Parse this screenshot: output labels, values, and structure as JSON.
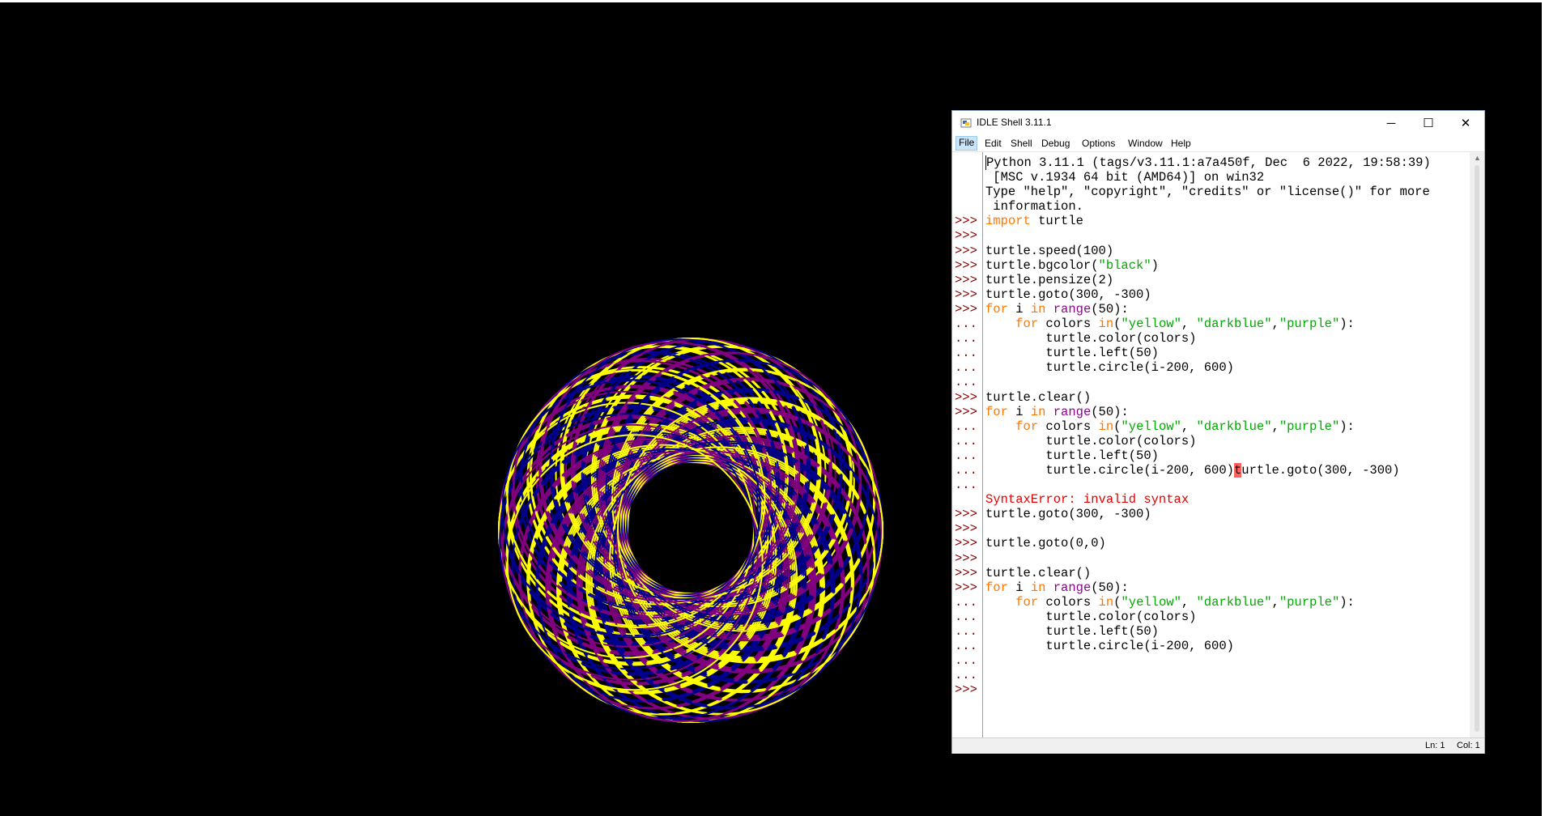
{
  "window": {
    "title": "IDLE Shell 3.11.1",
    "menu": [
      "File",
      "Edit",
      "Shell",
      "Debug",
      "Options",
      "Window",
      "Help"
    ],
    "active_menu": "File",
    "controls": {
      "minimize": "─",
      "maximize": "☐",
      "close": "✕"
    }
  },
  "shell": {
    "banner": [
      "Python 3.11.1 (tags/v3.11.1:a7a450f, Dec  6 2022, 19:58:39)",
      " [MSC v.1934 64 bit (AMD64)] on win32",
      "Type \"help\", \"copyright\", \"credits\" or \"license()\" for more",
      " information."
    ],
    "lines": [
      {
        "prompt": ">>>",
        "text": "import turtle"
      },
      {
        "prompt": ">>>",
        "text": ""
      },
      {
        "prompt": ">>>",
        "text": "turtle.speed(100)"
      },
      {
        "prompt": ">>>",
        "text": "turtle.bgcolor(\"black\")"
      },
      {
        "prompt": ">>>",
        "text": "turtle.pensize(2)"
      },
      {
        "prompt": ">>>",
        "text": "turtle.goto(300, -300)"
      },
      {
        "prompt": ">>>",
        "text": "for i in range(50):"
      },
      {
        "prompt": "...",
        "text": "    for colors in(\"yellow\", \"darkblue\",\"purple\"):"
      },
      {
        "prompt": "...",
        "text": "        turtle.color(colors)"
      },
      {
        "prompt": "...",
        "text": "        turtle.left(50)"
      },
      {
        "prompt": "...",
        "text": "        turtle.circle(i-200, 600)"
      },
      {
        "prompt": "...",
        "text": ""
      },
      {
        "prompt": ">>>",
        "text": "turtle.clear()"
      },
      {
        "prompt": ">>>",
        "text": "for i in range(50):"
      },
      {
        "prompt": "...",
        "text": "    for colors in(\"yellow\", \"darkblue\",\"purple\"):"
      },
      {
        "prompt": "...",
        "text": "        turtle.color(colors)"
      },
      {
        "prompt": "...",
        "text": "        turtle.left(50)"
      },
      {
        "prompt": "...",
        "text": "        turtle.circle(i-200, 600)turtle.goto(300, -300)"
      },
      {
        "prompt": "...",
        "text": ""
      },
      {
        "prompt": "",
        "text": "SyntaxError: invalid syntax"
      },
      {
        "prompt": ">>>",
        "text": "turtle.goto(300, -300)"
      },
      {
        "prompt": ">>>",
        "text": ""
      },
      {
        "prompt": ">>>",
        "text": "turtle.goto(0,0)"
      },
      {
        "prompt": ">>>",
        "text": ""
      },
      {
        "prompt": ">>>",
        "text": "turtle.clear()"
      },
      {
        "prompt": ">>>",
        "text": "for i in range(50):"
      },
      {
        "prompt": "...",
        "text": "    for colors in(\"yellow\", \"darkblue\",\"purple\"):"
      },
      {
        "prompt": "...",
        "text": "        turtle.color(colors)"
      },
      {
        "prompt": "...",
        "text": "        turtle.left(50)"
      },
      {
        "prompt": "...",
        "text": "        turtle.circle(i-200, 600)"
      },
      {
        "prompt": "...",
        "text": ""
      },
      {
        "prompt": "...",
        "text": ""
      },
      {
        "prompt": ">>>",
        "text": ""
      }
    ]
  },
  "status": {
    "line": "Ln: 1",
    "col": "Col: 1"
  },
  "turtle_drawing": {
    "background": "#000000",
    "pen_colors": [
      "yellow",
      "darkblue",
      "purple"
    ]
  },
  "colors": {
    "prompt": "#8b0000",
    "keyword": "#ff7700",
    "builtin": "#900090",
    "string": "#00aa00",
    "error": "#e00000",
    "error_highlight": "#ff6060"
  }
}
